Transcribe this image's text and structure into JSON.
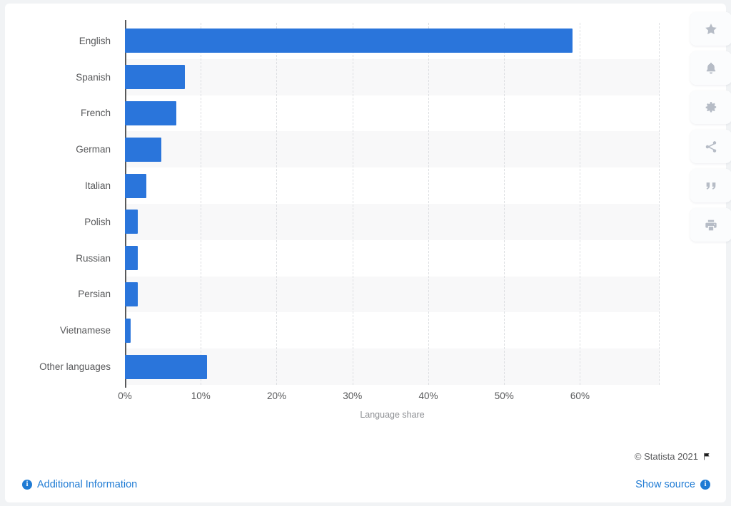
{
  "chart_data": {
    "type": "bar",
    "orientation": "horizontal",
    "title": "",
    "xlabel": "Language share",
    "ylabel": "",
    "categories": [
      "English",
      "Spanish",
      "French",
      "German",
      "Italian",
      "Polish",
      "Russian",
      "Persian",
      "Vietnamese",
      "Other languages"
    ],
    "values": [
      59.0,
      7.9,
      6.8,
      4.8,
      2.8,
      1.7,
      1.7,
      1.7,
      0.8,
      10.8
    ],
    "value_unit": "%",
    "xlim": [
      0,
      70.5
    ],
    "xticks": [
      0,
      10,
      20,
      30,
      40,
      50,
      60
    ],
    "xtick_labels": [
      "0%",
      "10%",
      "20%",
      "30%",
      "40%",
      "50%",
      "60%"
    ],
    "grid": "vertical-dashed",
    "legend": null,
    "bar_color": "#2a75db",
    "band_color": "#f8f8f9",
    "axis_color": "#58595b"
  },
  "toolbar": {
    "items": [
      {
        "name": "favorite-button",
        "icon": "star-icon"
      },
      {
        "name": "notification-button",
        "icon": "bell-icon"
      },
      {
        "name": "settings-button",
        "icon": "gear-icon"
      },
      {
        "name": "share-button",
        "icon": "share-icon"
      },
      {
        "name": "cite-button",
        "icon": "quote-icon"
      },
      {
        "name": "print-button",
        "icon": "print-icon"
      }
    ]
  },
  "footer": {
    "copyright": "© Statista 2021",
    "flag_icon": "flag-icon",
    "additional_information_label": "Additional Information",
    "show_source_label": "Show source",
    "info_icon_glyph": "i",
    "link_color": "#1f7bd4"
  }
}
